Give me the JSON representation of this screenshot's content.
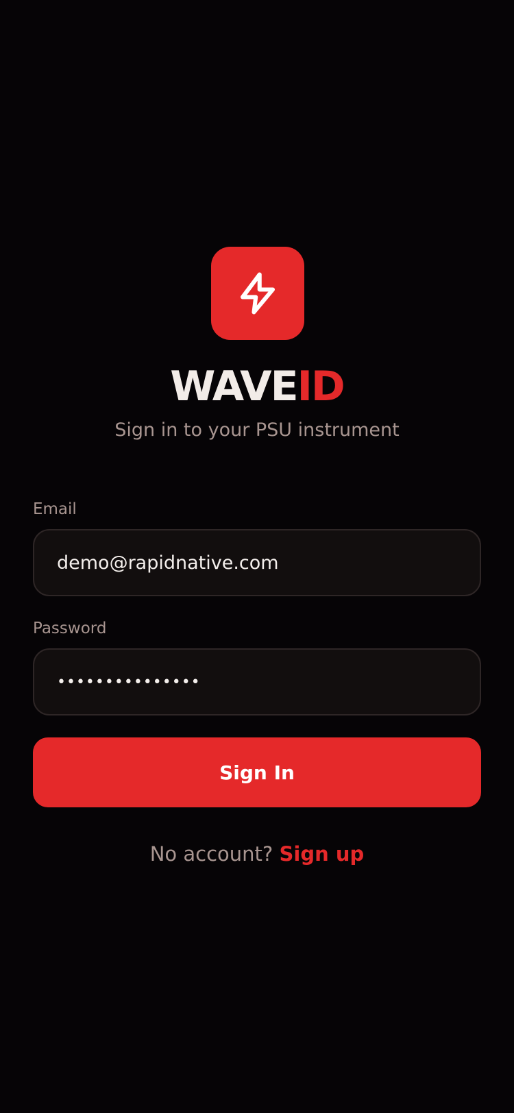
{
  "brand": {
    "name_part_a": "WAVE",
    "name_part_b": "ID",
    "subtitle": "Sign in to your PSU instrument",
    "logo_icon": "lightning-bolt-icon",
    "accent_color": "#e5292a"
  },
  "form": {
    "email": {
      "label": "Email",
      "value": "demo@rapidnative.com"
    },
    "password": {
      "label": "Password",
      "value": "•••••••••••••••"
    },
    "submit_label": "Sign In"
  },
  "footer": {
    "prompt": "No account?",
    "link_label": "Sign up"
  }
}
